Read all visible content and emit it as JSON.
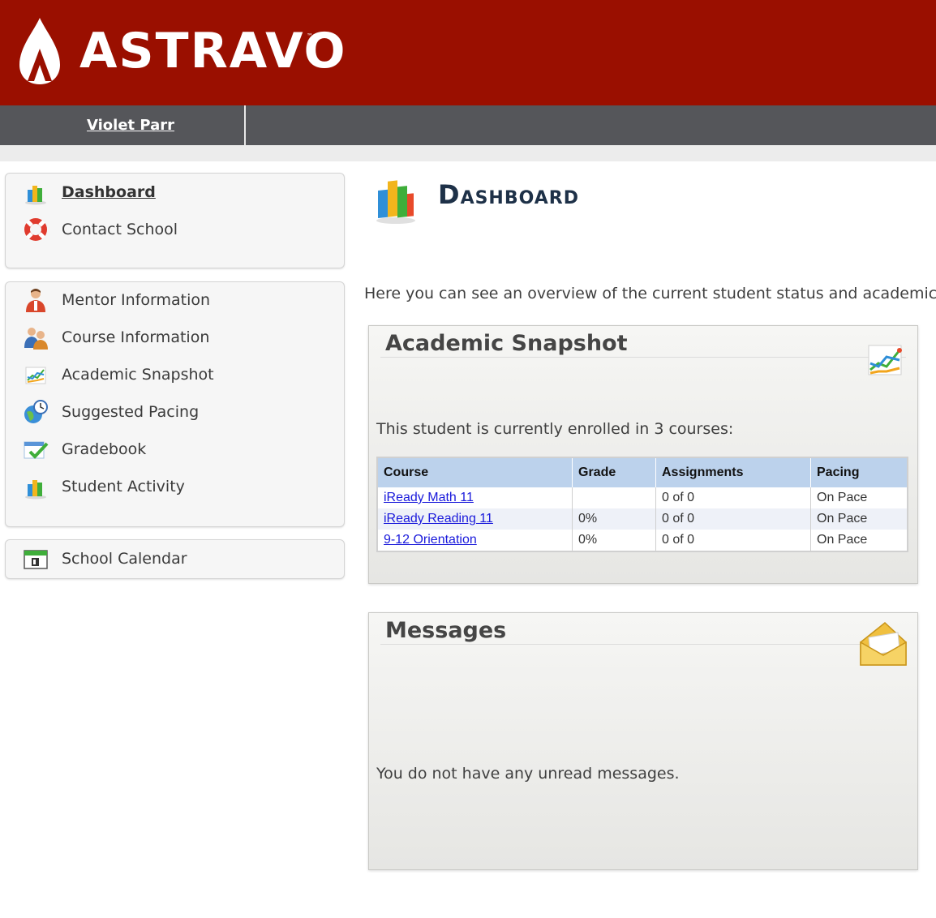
{
  "header": {
    "brand": "ASTRAVO",
    "user_name": "Violet Parr"
  },
  "colors": {
    "header_red": "#9a0f00",
    "user_bar": "#55565a",
    "title_navy": "#1e3148",
    "table_header": "#bcd2ec",
    "link": "#1a1adb"
  },
  "sidebar": {
    "group1": [
      {
        "label": "Dashboard",
        "icon": "bar-chart-icon",
        "active": true
      },
      {
        "label": "Contact School",
        "icon": "life-ring-icon"
      }
    ],
    "group2": [
      {
        "label": "Mentor Information",
        "icon": "person-icon"
      },
      {
        "label": "Course Information",
        "icon": "people-icon"
      },
      {
        "label": "Academic Snapshot",
        "icon": "line-chart-icon"
      },
      {
        "label": "Suggested Pacing",
        "icon": "globe-clock-icon"
      },
      {
        "label": "Gradebook",
        "icon": "checkmark-icon"
      },
      {
        "label": "Student Activity",
        "icon": "bar-chart-icon"
      }
    ],
    "group3": [
      {
        "label": "School Calendar",
        "icon": "calendar-icon"
      }
    ]
  },
  "main": {
    "title": "Dashboard",
    "intro": "Here you can see an overview of the current student status and academic p"
  },
  "snapshot": {
    "title": "Academic Snapshot",
    "enrolled_text": "This student is currently enrolled in 3 courses:",
    "columns": [
      "Course",
      "Grade",
      "Assignments",
      "Pacing"
    ],
    "rows": [
      {
        "course": "iReady Math 11",
        "grade": "",
        "assignments": "0 of 0",
        "pacing": "On Pace"
      },
      {
        "course": "iReady Reading 11",
        "grade": "0%",
        "assignments": "0 of 0",
        "pacing": "On Pace"
      },
      {
        "course": "9-12 Orientation",
        "grade": "0%",
        "assignments": "0 of 0",
        "pacing": "On Pace"
      }
    ]
  },
  "messages": {
    "title": "Messages",
    "empty_text": "You do not have any unread messages."
  }
}
